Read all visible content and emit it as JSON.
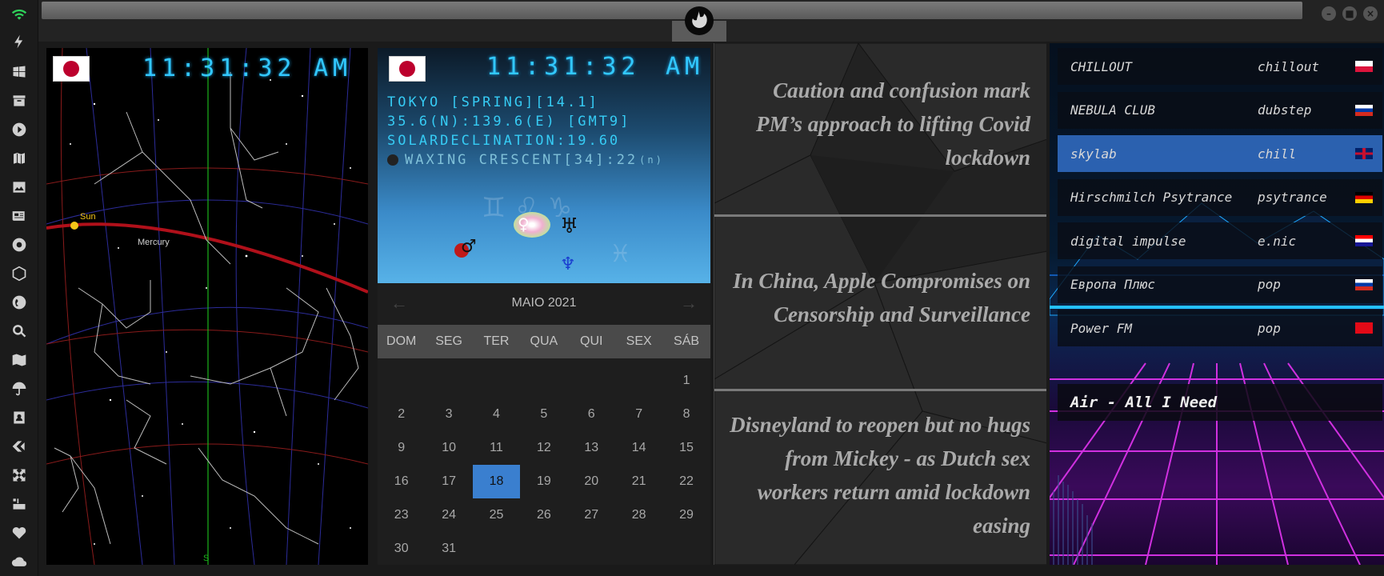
{
  "sidebar": {
    "icons": [
      "wifi-icon",
      "flash-icon",
      "windows-icon",
      "archive-icon",
      "play-icon",
      "map-book-icon",
      "image-icon",
      "news-icon",
      "aperture-icon",
      "hexagon-icon",
      "globe-icon",
      "search-icon",
      "map-icon",
      "umbrella-icon",
      "contacts-icon",
      "tag-icon",
      "expand-icon",
      "youtube-icon",
      "heart-icon",
      "cloud-icon"
    ]
  },
  "colors": {
    "accent": "#32c8ff",
    "calendar_today": "#3a7fcf",
    "wifi": "#2fd15a"
  },
  "sky": {
    "time": "11:31:32",
    "ampm": "AM",
    "labels": {
      "sun": "Sun",
      "mercury": "Mercury",
      "south": "S"
    }
  },
  "astro": {
    "time": "11:31:32",
    "ampm": "AM",
    "line1": "TOKYO [SPRING][14.1]",
    "line2": "35.6(N):139.6(E) [GMT9]",
    "line3": "SOLARDECLINATION:19.60",
    "line4": "WAXING CRESCENT[34]:22",
    "line4_unit": "(n)",
    "planets": {
      "venus": "♀",
      "uranus": "♅",
      "mars": "♂",
      "neptune": "♆"
    }
  },
  "calendar": {
    "month_label": "MAIO 2021",
    "prev": "←",
    "next": "→",
    "weekdays": [
      "DOM",
      "SEG",
      "TER",
      "QUA",
      "QUI",
      "SEX",
      "SÁB"
    ],
    "weeks": [
      [
        "",
        "",
        "",
        "",
        "",
        "",
        "1"
      ],
      [
        "2",
        "3",
        "4",
        "5",
        "6",
        "7",
        "8"
      ],
      [
        "9",
        "10",
        "11",
        "12",
        "13",
        "14",
        "15"
      ],
      [
        "16",
        "17",
        "18",
        "19",
        "20",
        "21",
        "22"
      ],
      [
        "23",
        "24",
        "25",
        "26",
        "27",
        "28",
        "29"
      ],
      [
        "30",
        "31",
        "",
        "",
        "",
        "",
        ""
      ]
    ],
    "today": "18"
  },
  "news": {
    "items": [
      "Caution and confusion mark PM’s approach to lifting Covid lockdown",
      "In China, Apple Compromises on Censorship and Surveillance",
      "Disneyland to reopen but no hugs from Mickey - as Dutch sex workers return amid lockdown easing"
    ]
  },
  "radio": {
    "stations": [
      {
        "name": "CHILLOUT",
        "genre": "chillout",
        "flag": "pl"
      },
      {
        "name": "NEBULA CLUB",
        "genre": "dubstep",
        "flag": "ru"
      },
      {
        "name": "skylab",
        "genre": "chill",
        "flag": "gb"
      },
      {
        "name": "Hirschmilch Psytrance",
        "genre": "psytrance",
        "flag": "de"
      },
      {
        "name": "digital impulse",
        "genre": "e.nic",
        "flag": "hr"
      },
      {
        "name": "Европа Плюс",
        "genre": "pop",
        "flag": "ru"
      },
      {
        "name": "Power FM",
        "genre": "pop",
        "flag": "tr"
      }
    ],
    "active_index": 2,
    "now_playing": "Air - All I Need"
  }
}
